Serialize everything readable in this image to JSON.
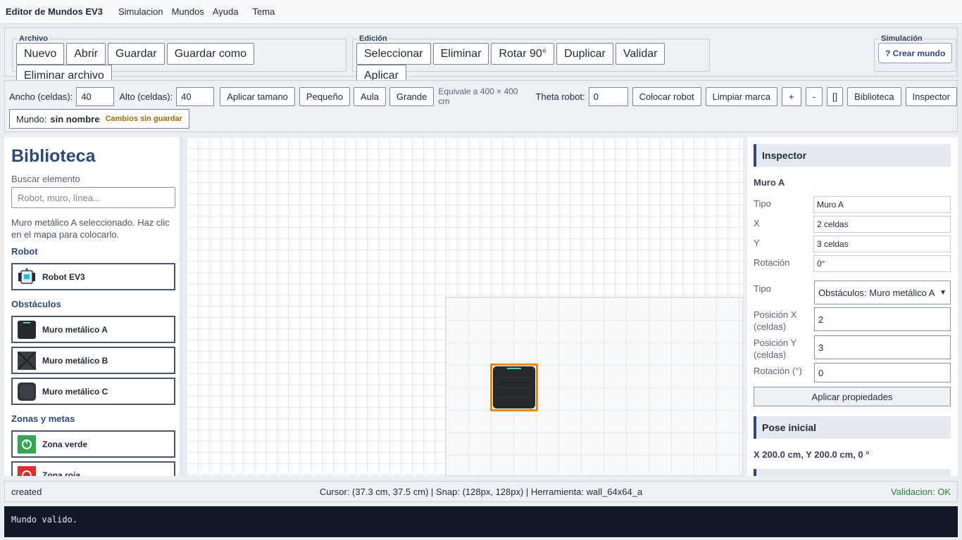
{
  "menu": {
    "app_title": "Editor de Mundos EV3",
    "items": [
      "Simulacion",
      "Mundos",
      "Ayuda",
      "Tema"
    ]
  },
  "toolbar": {
    "archivo": {
      "legend": "Archivo",
      "buttons": [
        "Nuevo",
        "Abrir",
        "Guardar",
        "Guardar como",
        "Eliminar archivo"
      ]
    },
    "edicion": {
      "legend": "Edición",
      "buttons": [
        "Seleccionar",
        "Eliminar",
        "Rotar 90°",
        "Duplicar",
        "Validar",
        "Aplicar"
      ]
    },
    "simulacion": {
      "legend": "Simulación",
      "button": "? Crear mundo"
    }
  },
  "dims": {
    "ancho_label": "Ancho (celdas):",
    "ancho_value": "40",
    "alto_label": "Alto (celdas):",
    "alto_value": "40",
    "apply_size": "Aplicar tamano",
    "presets": [
      "Pequeño",
      "Aula",
      "Grande"
    ],
    "equivale": "Equivale a 400 × 400 cm",
    "theta_label": "Theta robot:",
    "theta_value": "0",
    "colocar_robot": "Colocar robot",
    "limpiar_marca": "Limpiar marca",
    "zoom_in": "+",
    "zoom_out": "-",
    "fit": "[]",
    "biblioteca": "Biblioteca",
    "inspector": "Inspector"
  },
  "world_info": {
    "label": "Mundo:",
    "name": "sin nombre",
    "unsaved": "Cambios sin guardar"
  },
  "library": {
    "title": "Biblioteca",
    "search_label": "Buscar elemento",
    "search_placeholder": "Robot, muro, línea...",
    "hint": "Muro metálico A seleccionado. Haz clic en el mapa para colocarlo.",
    "sections": {
      "robot": {
        "title": "Robot",
        "items": [
          "Robot EV3"
        ]
      },
      "obstaculos": {
        "title": "Obstáculos",
        "items": [
          "Muro metálico A",
          "Muro metálico B",
          "Muro metálico C"
        ]
      },
      "zonas": {
        "title": "Zonas y metas",
        "items": [
          "Zona verde",
          "Zona roja"
        ]
      }
    }
  },
  "inspector": {
    "header": "Inspector",
    "selected_name": "Muro A",
    "readonly": [
      {
        "label": "Tipo",
        "value": "Muro A"
      },
      {
        "label": "X",
        "value": "2 celdas"
      },
      {
        "label": "Y",
        "value": "3 celdas"
      },
      {
        "label": "Rotación",
        "value": "0°"
      }
    ],
    "tipo_label": "Tipo",
    "tipo_value": "Obstáculos: Muro metálico A",
    "posx_label": "Posición X (celdas)",
    "posx_value": "2",
    "posy_label": "Posición Y (celdas)",
    "posy_value": "3",
    "rot_label": "Rotación (°)",
    "rot_value": "0",
    "apply": "Aplicar propiedades",
    "pose_header": "Pose inicial",
    "pose_value": "X 200.0 cm, Y 200.0 cm, 0 °"
  },
  "status": {
    "left": "created",
    "center": "Cursor: (37.3 cm, 37.5 cm) | Snap: (128px, 128px) | Herramienta: wall_64x64_a",
    "right": "Validacion: OK"
  },
  "console": {
    "text": "Mundo valido."
  },
  "colors": {
    "accent": "#2b4a77",
    "selection": "#e58a0c",
    "ok": "#2e7d32",
    "warning": "#a06a05",
    "console_bg": "#111827"
  }
}
